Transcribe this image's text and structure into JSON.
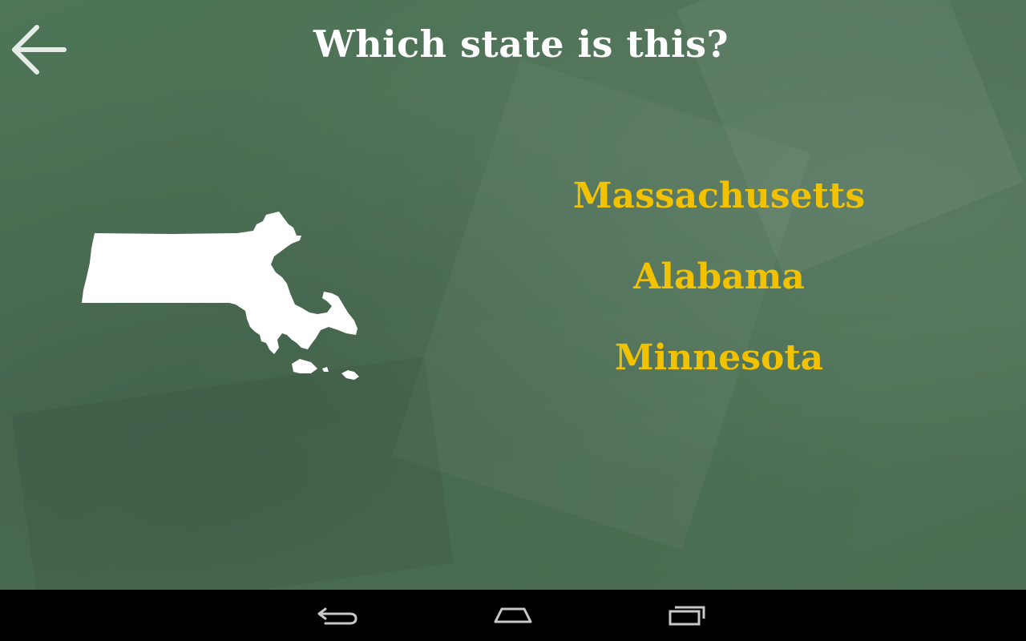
{
  "app": {
    "question": "Which state is this?"
  },
  "header": {
    "back_icon": "arrow-left-icon"
  },
  "quiz": {
    "state_shape_icon": "massachusetts-silhouette",
    "answers": [
      {
        "label": "Massachusetts"
      },
      {
        "label": "Alabama"
      },
      {
        "label": "Minnesota"
      }
    ],
    "colors": {
      "board": "#4d7256",
      "question_text": "#ffffff",
      "answer_text": "#f2c200",
      "shape": "#ffffff"
    }
  },
  "system_nav": {
    "back_icon": "nav-back-icon",
    "home_icon": "nav-home-icon",
    "recents_icon": "nav-recents-icon",
    "color": "#000000"
  }
}
